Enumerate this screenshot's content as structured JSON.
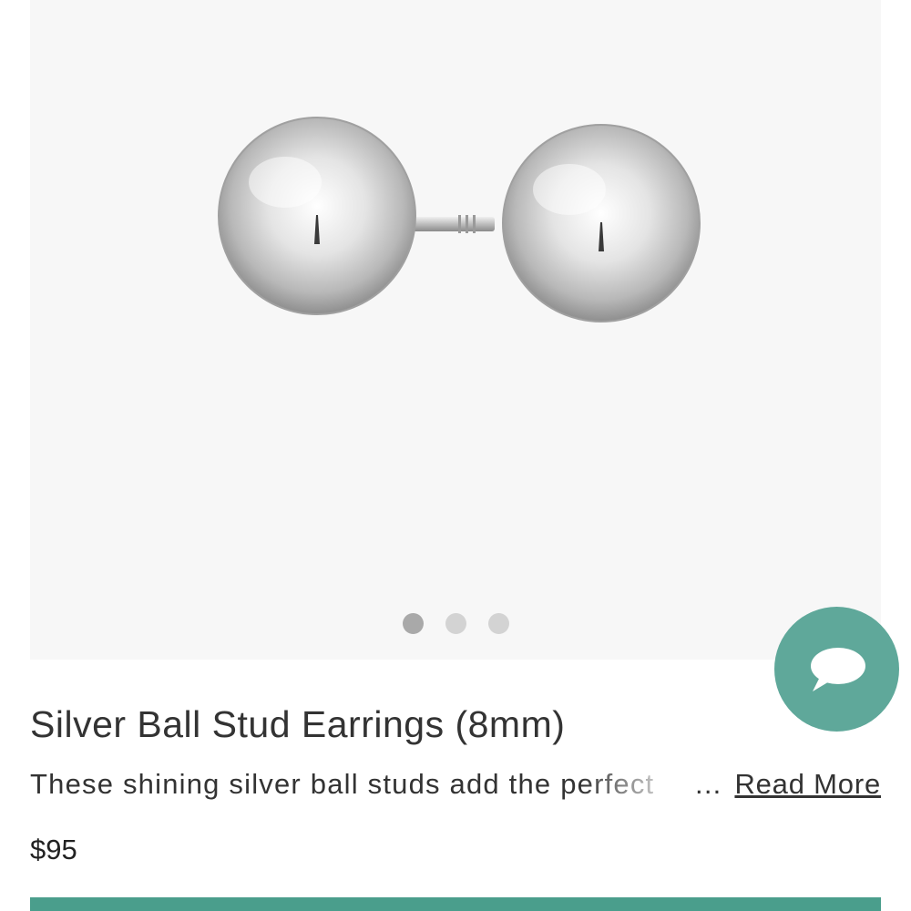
{
  "product": {
    "title": "Silver Ball Stud Earrings (8mm)",
    "description": "These shining silver ball studs add the perfect",
    "ellipsis": "...",
    "read_more_label": "Read More",
    "price": "$95"
  },
  "gallery": {
    "image_count": 3,
    "active_index": 0
  },
  "chat": {
    "icon": "speech-bubble-icon"
  },
  "colors": {
    "accent": "#5fa89a",
    "cta": "#4a9e8c",
    "gallery_background": "#f7f7f7"
  }
}
